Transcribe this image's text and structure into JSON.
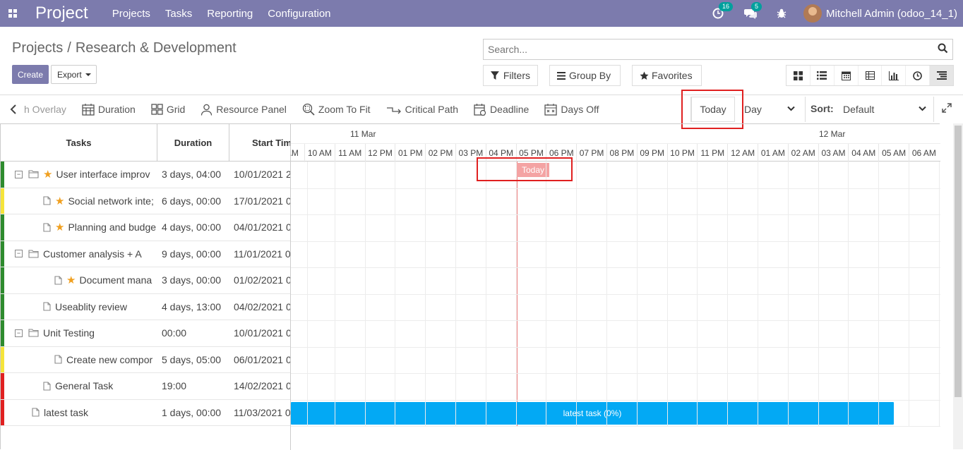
{
  "navbar": {
    "brand": "Project",
    "menus": [
      "Projects",
      "Tasks",
      "Reporting",
      "Configuration"
    ],
    "activity_count": "16",
    "message_count": "5",
    "user": "Mitchell Admin (odoo_14_1)"
  },
  "breadcrumb": {
    "parent": "Projects",
    "separator": "/",
    "current": "Research & Development"
  },
  "actions": {
    "create": "Create",
    "export": "Export"
  },
  "search": {
    "placeholder": "Search..."
  },
  "filters": {
    "filters": "Filters",
    "group_by": "Group By",
    "favorites": "Favorites"
  },
  "views": [
    "kanban-icon",
    "list-icon",
    "calendar-icon",
    "pivot-icon",
    "graph-icon",
    "activity-icon",
    "gantt-icon"
  ],
  "toolbar": {
    "overlay": "h Overlay",
    "duration": "Duration",
    "grid": "Grid",
    "resource_panel": "Resource Panel",
    "zoom_to_fit": "Zoom To Fit",
    "critical_path": "Critical Path",
    "deadline": "Deadline",
    "days_off": "Days Off",
    "today": "Today",
    "scale": "Day",
    "sort_label": "Sort:",
    "sort_value": "Default"
  },
  "grid": {
    "columns": [
      "Tasks",
      "Duration",
      "Start Tim"
    ],
    "rows": [
      {
        "name": "User interface improv",
        "duration": "3 days, 04:00",
        "start": "10/01/2021 2",
        "priority": "#2e8b2e",
        "type": "folder",
        "star": true,
        "toggle": true
      },
      {
        "name": "Social network inte;",
        "duration": "6 days, 00:00",
        "start": "17/01/2021 0",
        "priority": "#f5e43a",
        "type": "file",
        "star": true,
        "toggle": false
      },
      {
        "name": "Planning and budge",
        "duration": "4 days, 00:00",
        "start": "04/01/2021 0",
        "priority": "#2e8b2e",
        "type": "file",
        "star": true,
        "toggle": false
      },
      {
        "name": "Customer analysis + A",
        "duration": "9 days, 00:00",
        "start": "11/01/2021 0",
        "priority": "#2e8b2e",
        "type": "folder",
        "star": false,
        "toggle": true
      },
      {
        "name": "Document mana",
        "duration": "3 days, 00:00",
        "start": "01/02/2021 0",
        "priority": "#2e8b2e",
        "type": "file",
        "star": true,
        "toggle": false
      },
      {
        "name": "Useablity review",
        "duration": "4 days, 13:00",
        "start": "04/02/2021 0",
        "priority": "#2e8b2e",
        "type": "file",
        "star": false,
        "toggle": false
      },
      {
        "name": "Unit Testing",
        "duration": "00:00",
        "start": "10/01/2021 0",
        "priority": "#2e8b2e",
        "type": "folder",
        "star": false,
        "toggle": true
      },
      {
        "name": "Create new compor",
        "duration": "5 days, 05:00",
        "start": "06/01/2021 0",
        "priority": "#f5e43a",
        "type": "file",
        "star": false,
        "toggle": false
      },
      {
        "name": "General Task",
        "duration": "19:00",
        "start": "14/02/2021 0",
        "priority": "#e02020",
        "type": "file",
        "star": false,
        "toggle": false
      },
      {
        "name": "latest task",
        "duration": "1 days, 00:00",
        "start": "11/03/2021 0",
        "priority": "#e02020",
        "type": "file",
        "star": false,
        "toggle": false
      }
    ]
  },
  "timeline": {
    "days": [
      "11 Mar",
      "12 Mar"
    ],
    "hours": [
      "AM",
      "10 AM",
      "11 AM",
      "12 PM",
      "01 PM",
      "02 PM",
      "03 PM",
      "04 PM",
      "05 PM",
      "06 PM",
      "07 PM",
      "08 PM",
      "09 PM",
      "10 PM",
      "11 PM",
      "12 AM",
      "01 AM",
      "02 AM",
      "03 AM",
      "04 AM",
      "05 AM",
      "06 AM"
    ],
    "today_label": "Today",
    "bar_label": "latest task (0%)",
    "bar_color": "#03a9f4"
  }
}
